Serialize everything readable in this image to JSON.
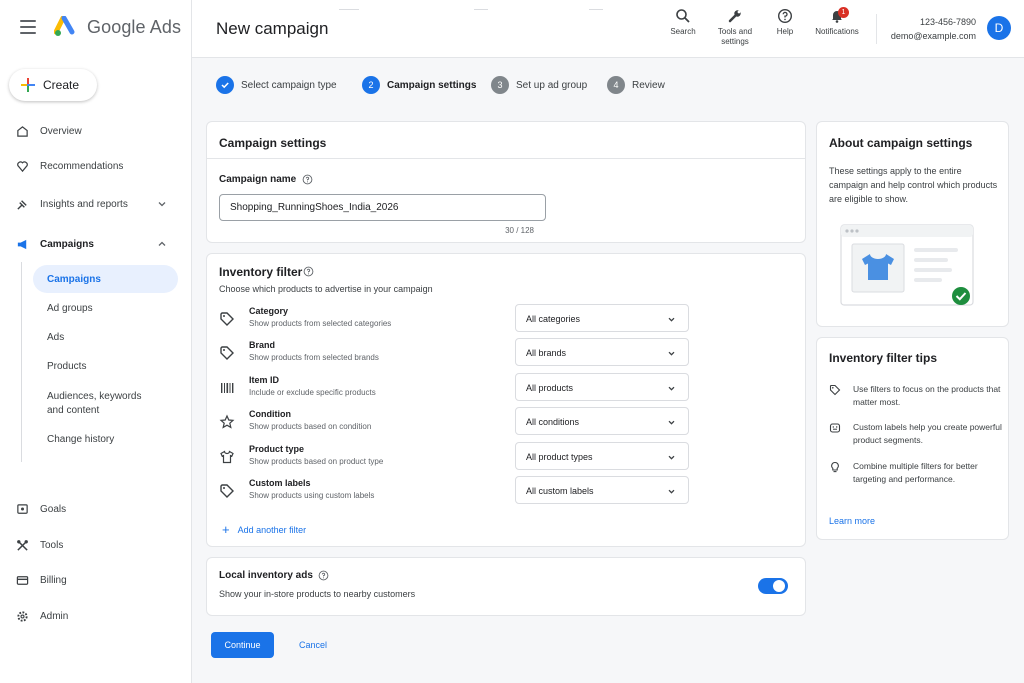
{
  "app": {
    "brand": "Google Ads",
    "page_title": "New campaign"
  },
  "sidebar": {
    "create_label": "Create",
    "items": [
      {
        "label": "Overview",
        "icon": "home-icon"
      },
      {
        "label": "Recommendations",
        "icon": "bulb-icon"
      },
      {
        "label": "Insights and reports",
        "icon": "insights-icon"
      },
      {
        "label": "Campaigns",
        "icon": "megaphone-icon"
      },
      {
        "label": "Goals",
        "icon": "goals-icon"
      },
      {
        "label": "Tools",
        "icon": "tools-icon"
      },
      {
        "label": "Billing",
        "icon": "billing-icon"
      },
      {
        "label": "Admin",
        "icon": "admin-gear-icon"
      }
    ],
    "campaign_subitems": [
      {
        "label": "Campaigns",
        "active": true
      },
      {
        "label": "Ad groups"
      },
      {
        "label": "Ads"
      },
      {
        "label": "Products"
      },
      {
        "label": "Audiences, keywords and content"
      },
      {
        "label": "Change history"
      }
    ]
  },
  "topbar": {
    "search_label": "Search",
    "tools_label": "Tools and settings",
    "help_label": "Help",
    "notifications_label": "Notifications",
    "notification_count": "1",
    "account_phone": "123-456-7890",
    "account_email": "demo@example.com",
    "avatar_initial": "D"
  },
  "stepper": {
    "steps": [
      {
        "number": "1",
        "label": "Select campaign type",
        "state": "done"
      },
      {
        "number": "2",
        "label": "Campaign settings",
        "state": "active"
      },
      {
        "number": "3",
        "label": "Set up ad group",
        "state": "pending"
      },
      {
        "number": "4",
        "label": "Review",
        "state": "pending"
      }
    ]
  },
  "settings": {
    "title": "Campaign settings",
    "campaign_name_label": "Campaign name",
    "campaign_name_value": "Shopping_RunningShoes_India_2026",
    "char_counter": "30 / 128"
  },
  "inventory": {
    "title": "Inventory filter",
    "description": "Choose which products to advertise in your campaign",
    "filters": [
      {
        "name": "Category",
        "desc": "Show products from selected categories",
        "value": "All categories",
        "icon": "tag-icon"
      },
      {
        "name": "Brand",
        "desc": "Show products from selected brands",
        "value": "All brands",
        "icon": "tag-icon"
      },
      {
        "name": "Item ID",
        "desc": "Include or exclude specific products",
        "value": "All products",
        "icon": "barcode-icon"
      },
      {
        "name": "Condition",
        "desc": "Show products based on condition",
        "value": "All conditions",
        "icon": "star-icon"
      },
      {
        "name": "Product type",
        "desc": "Show products based on product type",
        "value": "All product types",
        "icon": "shirt-icon"
      },
      {
        "name": "Custom labels",
        "desc": "Show products using custom labels",
        "value": "All custom labels",
        "icon": "tag-icon"
      }
    ],
    "add_filter_label": "Add another filter"
  },
  "local_inventory": {
    "title": "Local inventory ads",
    "description": "Show your in-store products to nearby customers",
    "enabled": true
  },
  "actions": {
    "continue_label": "Continue",
    "cancel_label": "Cancel"
  },
  "about": {
    "title": "About campaign settings",
    "text": "These settings apply to the entire campaign and help control which products are eligible to show."
  },
  "tips": {
    "title": "Inventory filter tips",
    "items": [
      {
        "text": "Use filters to focus on the products that matter most.",
        "icon": "tag-icon"
      },
      {
        "text": "Custom labels help you create powerful product segments.",
        "icon": "label-face-icon"
      },
      {
        "text": "Combine multiple filters for better targeting and performance.",
        "icon": "bulb-icon"
      }
    ],
    "learn_more_label": "Learn more"
  },
  "colors": {
    "accent": "#1a73e8",
    "success": "#1e8e3e",
    "badge": "#d93025",
    "shirt": "#4a90e2"
  }
}
